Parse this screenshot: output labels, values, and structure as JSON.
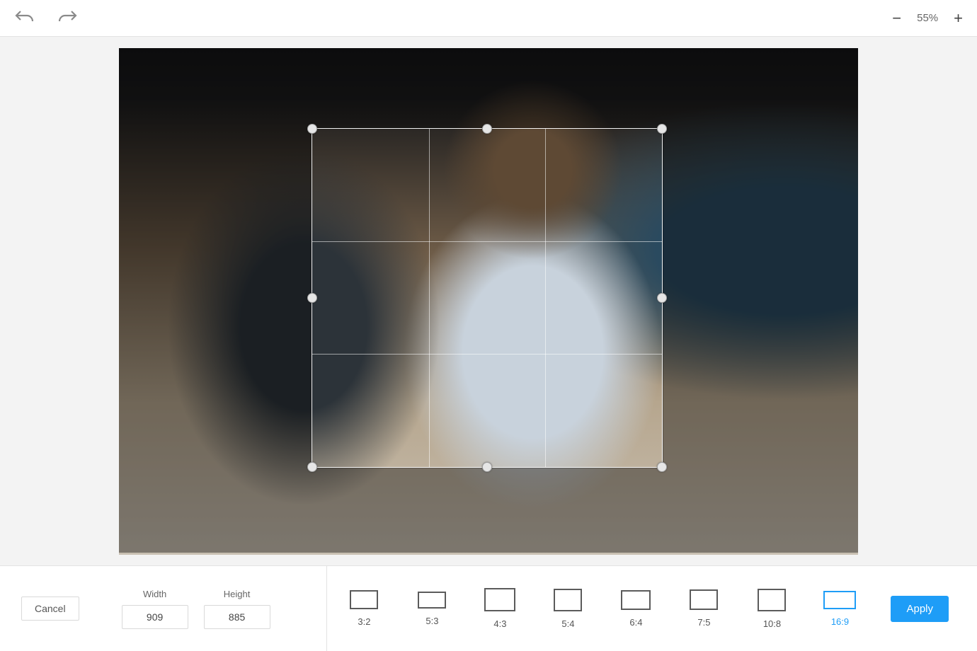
{
  "toolbar": {
    "zoom_level": "55%"
  },
  "crop": {
    "width_label": "Width",
    "height_label": "Height",
    "width_value": "909",
    "height_value": "885"
  },
  "buttons": {
    "cancel": "Cancel",
    "apply": "Apply"
  },
  "ratios": [
    {
      "id": "3:2",
      "label": "3:2",
      "box": "r32",
      "selected": false
    },
    {
      "id": "5:3",
      "label": "5:3",
      "box": "r53",
      "selected": false
    },
    {
      "id": "4:3",
      "label": "4:3",
      "box": "r43",
      "selected": false
    },
    {
      "id": "5:4",
      "label": "5:4",
      "box": "r54",
      "selected": false
    },
    {
      "id": "6:4",
      "label": "6:4",
      "box": "r64",
      "selected": false
    },
    {
      "id": "7:5",
      "label": "7:5",
      "box": "r75",
      "selected": false
    },
    {
      "id": "10:8",
      "label": "10:8",
      "box": "r108",
      "selected": false
    },
    {
      "id": "16:9",
      "label": "16:9",
      "box": "r169",
      "selected": true
    }
  ]
}
